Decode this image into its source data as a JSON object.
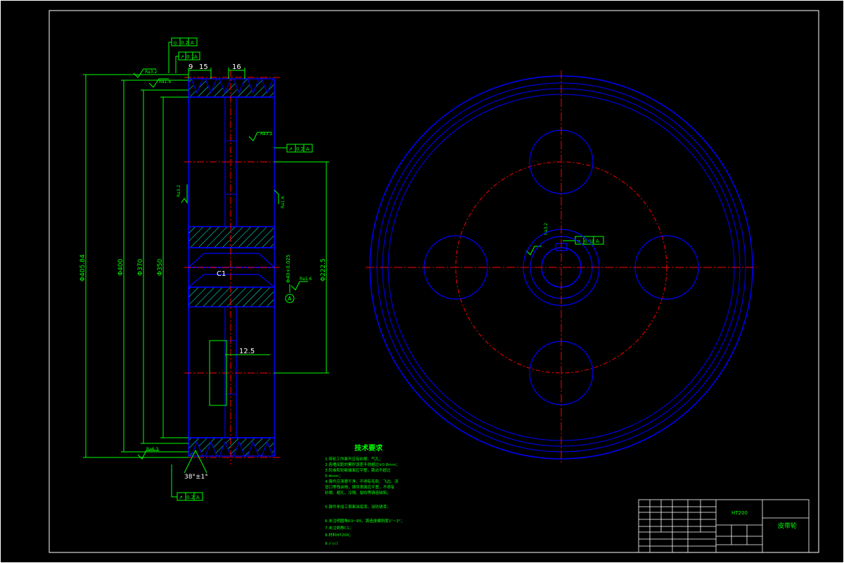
{
  "dimensions": {
    "groove_pitch": "16",
    "groove_offset": "9",
    "groove_width": "15",
    "dia_outer": "Φ405.84",
    "dia_400": "Φ400",
    "dia_370": "Φ370",
    "dia_350": "Φ350",
    "dia_pcd": "Φ222.5",
    "chamfer": "C1",
    "hub_len": "12.5",
    "bore_tol": "Φ40+0.025",
    "groove_angle": "38°±1°",
    "datum": "A"
  },
  "roughness": {
    "top": "Ra3.2",
    "rim": "Ra1.6",
    "side": "Ra3.2",
    "face": "Ra3.2",
    "right": "Ra1.6",
    "bore": "Ra1.6",
    "bottom": "Ra6.3",
    "key": "Ra3.2"
  },
  "tolerance": {
    "top1_sym": "◎",
    "top1_val": "0.2",
    "top1_ref": "A",
    "top2_sym": "↗",
    "top2_val": "0.1",
    "top2_ref": "A",
    "right_sym": "↗",
    "right_val": "0.2",
    "right_ref": "A",
    "bottom_sym": "↗",
    "bottom_val": "0.2",
    "bottom_ref": "A",
    "key_sym": "≡",
    "key_val": "0.02",
    "key_ref": "A"
  },
  "notes": {
    "title": "技术要求",
    "lines": [
      "1.带轮工作面不应有砂眼、气孔；",
      "2.各槽间距的累积误差不得超过±0.8mm；",
      "3.轮缘和轮毂端面应平整，跳动不超过",
      "  0.4mm；",
      "4.铸件应清理干净，不得有毛刺、飞边、浇",
      "  冒口等残余物，铸件表面应平整，不得有",
      "  砂眼、缩孔、冷隔、裂纹等铸造缺陷；",
      "5.铸件非加工表面涂底漆，涂防锈漆；",
      "6.未注明圆角R3~R5，铸造拔模斜度1°~3°；",
      "7.未注倒角C1；",
      "8.材料HT200；",
      "9.√ (√)"
    ]
  },
  "title_block": {
    "material": "HT200",
    "part_name": "皮带轮"
  },
  "colors": {
    "background": "#000000",
    "frame": "#ffffff",
    "outline": "#0000ff",
    "dimension": "#00ff00",
    "centerline": "#ff0000",
    "hatch": "#00ffff"
  }
}
